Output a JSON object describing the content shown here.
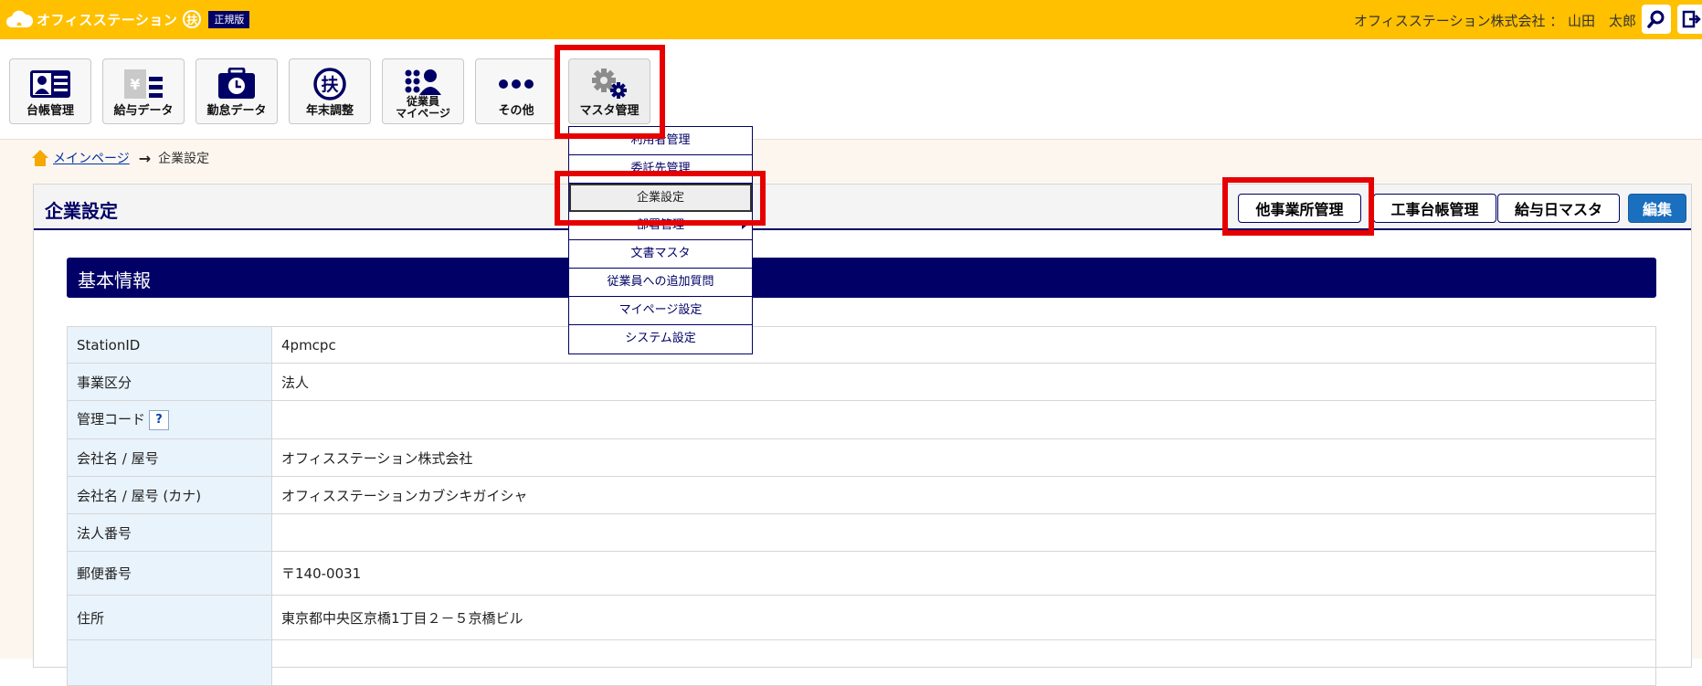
{
  "header": {
    "brand": "オフィスステーション",
    "fu_badge": "扶",
    "edition": "正規版",
    "user": "オフィスステーション株式会社 ： 山田　太郎"
  },
  "nav": [
    {
      "label": "台帳管理",
      "icon": "ledger-icon"
    },
    {
      "label": "給与データ",
      "icon": "salary-icon"
    },
    {
      "label": "勤怠データ",
      "icon": "attendance-icon"
    },
    {
      "label": "年末調整",
      "icon": "year-end-adjustment-icon"
    },
    {
      "label1": "従業員",
      "label2": "マイページ",
      "icon": "employee-mypage-icon"
    },
    {
      "label": "その他",
      "icon": "more-icon"
    },
    {
      "label": "マスタ管理",
      "icon": "gear-icon"
    }
  ],
  "breadcrumb": {
    "home": "メインページ",
    "current": "企業設定"
  },
  "panel": {
    "title": "企業設定",
    "buttons": {
      "other_offices": "他事業所管理",
      "construction_ledger": "工事台帳管理",
      "payday_master": "給与日マスタ",
      "edit": "編集"
    },
    "section_title": "基本情報"
  },
  "table": [
    {
      "key": "StationID",
      "value": "4pmcpc"
    },
    {
      "key": "事業区分",
      "value": "法人"
    },
    {
      "key": "管理コード",
      "value": "",
      "help": "?"
    },
    {
      "key": "会社名 / 屋号",
      "value": "オフィスステーション株式会社"
    },
    {
      "key": "会社名 / 屋号 (カナ)",
      "value": "オフィスステーションカブシキガイシャ"
    },
    {
      "key": "法人番号",
      "value": ""
    },
    {
      "key": "郵便番号",
      "value": "〒140-0031"
    },
    {
      "key": "住所",
      "value": "東京都中央区京橋1丁目２－５京橋ビル"
    }
  ],
  "dropdown": [
    "利用者管理",
    "委託先管理",
    "企業設定",
    "部署管理",
    "文書マスタ",
    "従業員への追加質問",
    "マイページ設定",
    "システム設定"
  ],
  "colors": {
    "topbar": "#ffc000",
    "navy": "#000066",
    "highlight": "#e60000",
    "primary": "#1a6fbf"
  }
}
